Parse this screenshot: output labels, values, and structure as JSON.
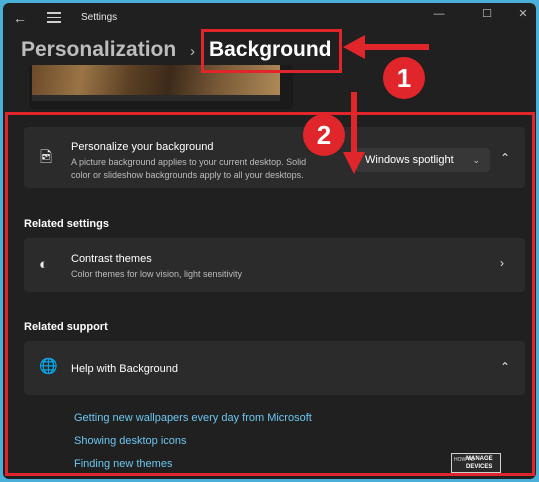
{
  "window": {
    "title": "Settings"
  },
  "breadcrumb": {
    "parent": "Personalization",
    "separator": "›",
    "current": "Background"
  },
  "annotations": {
    "badge_1": "1",
    "badge_2": "2"
  },
  "background_card": {
    "title": "Personalize your background",
    "description_line1": "A picture background applies to your current desktop. Solid",
    "description_line2": "color or slideshow backgrounds apply to all your desktops.",
    "dropdown_value": "Windows spotlight"
  },
  "related_settings": {
    "heading": "Related settings",
    "contrast": {
      "title": "Contrast themes",
      "description": "Color themes for low vision, light sensitivity"
    }
  },
  "related_support": {
    "heading": "Related support",
    "help_title": "Help with Background",
    "links": [
      "Getting new wallpapers every day from Microsoft",
      "Showing desktop icons",
      "Finding new themes"
    ]
  },
  "watermark": {
    "line1": "HOW TO",
    "line2": "MANAGE",
    "line3": "DEVICES"
  },
  "colors": {
    "annotation_red": "#e0262a",
    "link_blue": "#6cc6f0",
    "background": "#202020",
    "card": "#2b2b2b"
  }
}
